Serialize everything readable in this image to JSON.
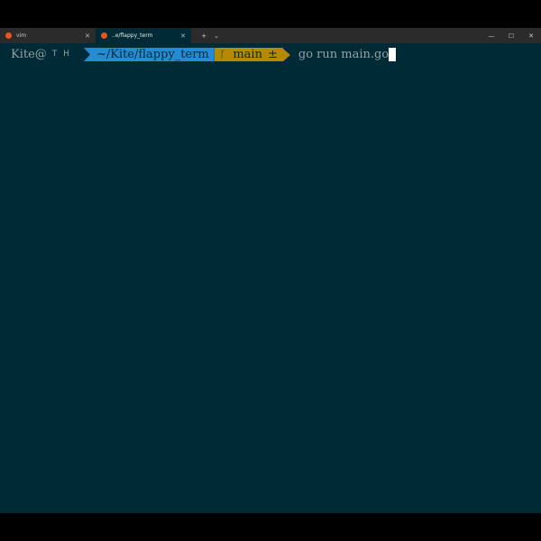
{
  "colors": {
    "background": "#002b36",
    "path_segment": "#268bd2",
    "git_segment": "#b58900",
    "text": "#93a1a1",
    "tab_icon": "#e95420"
  },
  "tabs": [
    {
      "label": "vim",
      "icon": "ubuntu-icon",
      "active": false
    },
    {
      "label": "..e/flappy_term",
      "icon": "ubuntu-icon",
      "active": true
    }
  ],
  "tab_actions": {
    "new_tab": "+",
    "dropdown": "⌄"
  },
  "window_controls": {
    "minimize": "—",
    "maximize": "☐",
    "close": "✕"
  },
  "prompt": {
    "user": "Kite@",
    "status": "T H",
    "path": "~/Kite/flappy_term",
    "git_icon": "ᚴ",
    "branch": "main",
    "dirty_marker": "±",
    "command": "go run main.go"
  }
}
